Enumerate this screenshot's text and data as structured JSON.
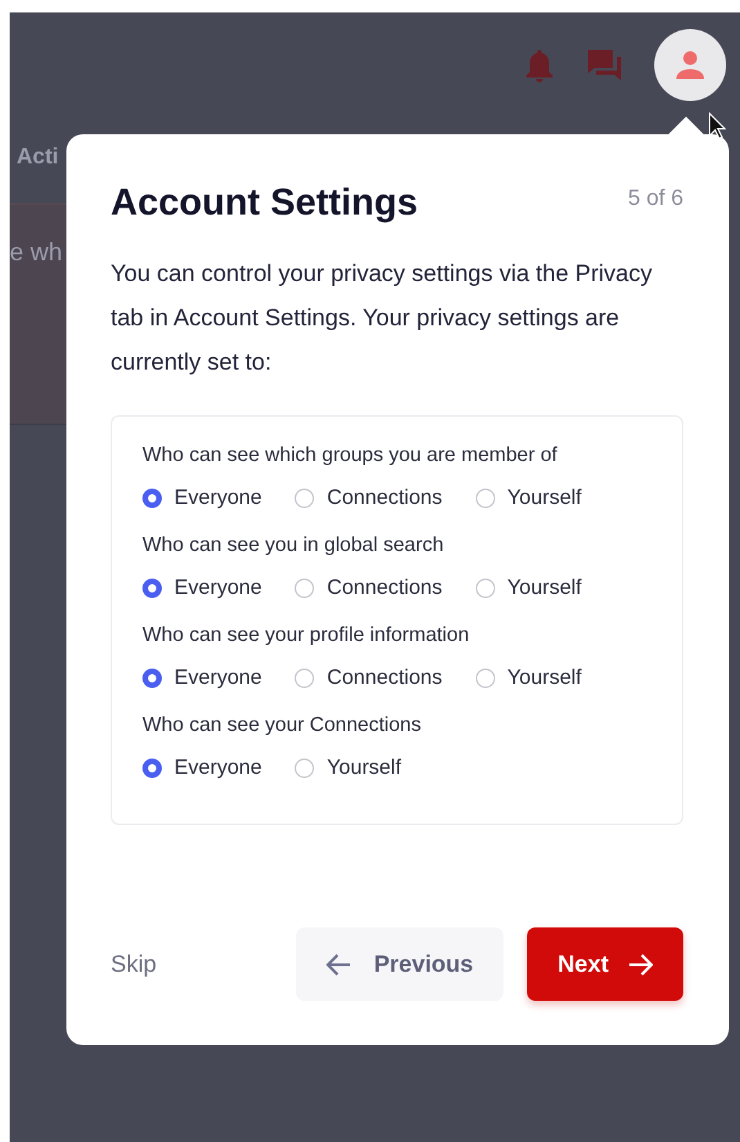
{
  "background": {
    "tab_text": "Acti",
    "body_text": "e wh"
  },
  "popover": {
    "title": "Account Settings",
    "step": "5 of 6",
    "description": "You can control your privacy settings via the Privacy tab in Account Settings. Your privacy settings are currently set to:",
    "questions": [
      {
        "label": "Who can see which groups you are member of",
        "options": [
          {
            "label": "Everyone",
            "selected": true
          },
          {
            "label": "Connections",
            "selected": false
          },
          {
            "label": "Yourself",
            "selected": false
          }
        ]
      },
      {
        "label": "Who can see you in global search",
        "options": [
          {
            "label": "Everyone",
            "selected": true
          },
          {
            "label": "Connections",
            "selected": false
          },
          {
            "label": "Yourself",
            "selected": false
          }
        ]
      },
      {
        "label": "Who can see your profile information",
        "options": [
          {
            "label": "Everyone",
            "selected": true
          },
          {
            "label": "Connections",
            "selected": false
          },
          {
            "label": "Yourself",
            "selected": false
          }
        ]
      },
      {
        "label": "Who can see your Connections",
        "options": [
          {
            "label": "Everyone",
            "selected": true
          },
          {
            "label": "Yourself",
            "selected": false
          }
        ]
      }
    ],
    "skip": "Skip",
    "previous": "Previous",
    "next": "Next"
  }
}
